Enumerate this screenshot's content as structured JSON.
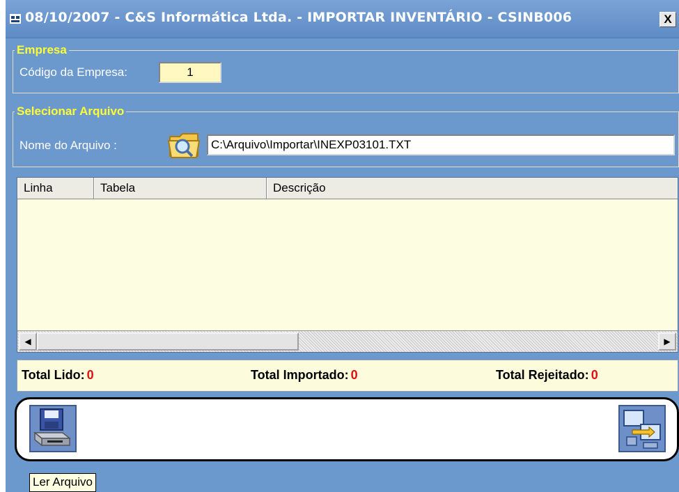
{
  "window": {
    "title": "08/10/2007 - C&S Informática Ltda. - IMPORTAR INVENTÁRIO - CSINB006",
    "close_label": "X"
  },
  "empresa": {
    "legend": "Empresa",
    "label": "Código da Empresa:",
    "value": "1"
  },
  "arquivo": {
    "legend": "Selecionar Arquivo",
    "label": "Nome do Arquivo :",
    "path": "C:\\Arquivo\\Importar\\INEXP03101.TXT",
    "browse_icon": "folder-search-icon"
  },
  "grid": {
    "columns": [
      "Linha",
      "Tabela",
      "Descrição"
    ],
    "rows": []
  },
  "totals": {
    "lido_label": "Total Lido:",
    "lido_value": "0",
    "importado_label": "Total Importado:",
    "importado_value": "0",
    "rejeitado_label": "Total Rejeitado:",
    "rejeitado_value": "0"
  },
  "toolbar": {
    "read_icon": "floppy-drive-icon",
    "exit_icon": "computers-transfer-icon",
    "tooltip": "Ler Arquivo"
  },
  "colors": {
    "window_bg": "#6b98cd",
    "legend": "#ffff33",
    "total_value": "#e01010",
    "grid_bg": "#fdfde2"
  }
}
